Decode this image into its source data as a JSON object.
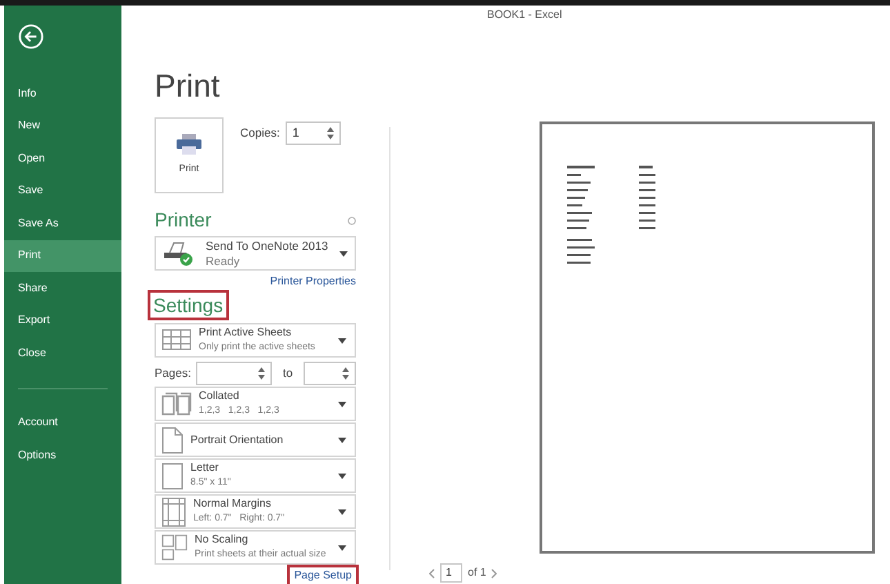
{
  "window": {
    "title": "BOOK1 - Excel"
  },
  "sidebar": {
    "items": [
      {
        "label": "Info",
        "selected": false
      },
      {
        "label": "New",
        "selected": false
      },
      {
        "label": "Open",
        "selected": false
      },
      {
        "label": "Save",
        "selected": false
      },
      {
        "label": "Save As",
        "selected": false
      },
      {
        "label": "Print",
        "selected": true
      },
      {
        "label": "Share",
        "selected": false
      },
      {
        "label": "Export",
        "selected": false
      },
      {
        "label": "Close",
        "selected": false
      }
    ],
    "footer_items": [
      {
        "label": "Account",
        "selected": false
      },
      {
        "label": "Options",
        "selected": false
      }
    ]
  },
  "heading": "Print",
  "print_button": {
    "label": "Print"
  },
  "copies": {
    "label": "Copies:",
    "value": "1"
  },
  "printer": {
    "heading": "Printer",
    "name": "Send To OneNote 2013",
    "status": "Ready",
    "link": "Printer Properties"
  },
  "settings": {
    "heading": "Settings",
    "highlighted": true,
    "options": [
      {
        "kind": "sheets",
        "title": "Print Active Sheets",
        "subtitle": "Only print the active sheets"
      },
      {
        "kind": "pages",
        "label": "Pages:",
        "to": "to"
      },
      {
        "kind": "collated",
        "title": "Collated",
        "subtitle": "1,2,3   1,2,3   1,2,3"
      },
      {
        "kind": "orientation",
        "title": "Portrait Orientation"
      },
      {
        "kind": "paper",
        "title": "Letter",
        "subtitle": "8.5\" x 11\""
      },
      {
        "kind": "margins",
        "title": "Normal Margins",
        "subtitle": "Left: 0.7\"   Right: 0.7\""
      },
      {
        "kind": "scaling",
        "title": "No Scaling",
        "subtitle": "Print sheets at their actual size"
      }
    ],
    "page_setup": {
      "label": "Page Setup",
      "highlighted": true
    }
  },
  "pager": {
    "value": "1",
    "total": "of 1"
  }
}
